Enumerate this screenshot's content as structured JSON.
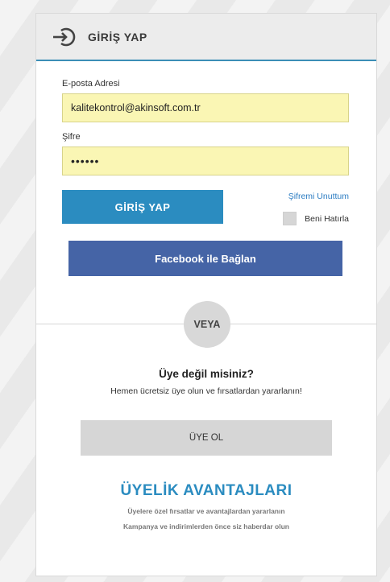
{
  "header": {
    "title": "GİRİŞ YAP",
    "icon": "login-icon"
  },
  "form": {
    "email": {
      "label": "E-posta Adresi",
      "value": "kalitekontrol@akinsoft.com.tr"
    },
    "password": {
      "label": "Şifre",
      "value": "••••••"
    },
    "login_button": "GİRİŞ YAP",
    "forgot_link": "Şifremi Unuttum",
    "remember_label": "Beni Hatırla",
    "facebook_button": "Facebook ile Bağlan"
  },
  "divider": {
    "label": "VEYA"
  },
  "register": {
    "title": "Üye değil misiniz?",
    "subtitle": "Hemen ücretsiz üye olun ve fırsatlardan yararlanın!",
    "button": "ÜYE OL"
  },
  "benefits": {
    "title": "ÜYELİK AVANTAJLARI",
    "items": [
      "Üyelere özel fırsatlar ve avantajlardan yararlanın",
      "Kampanya ve indirimlerden önce siz haberdar olun"
    ]
  },
  "colors": {
    "accent": "#2b8cc0",
    "facebook": "#4564a6",
    "input_bg": "#faf6b4"
  }
}
